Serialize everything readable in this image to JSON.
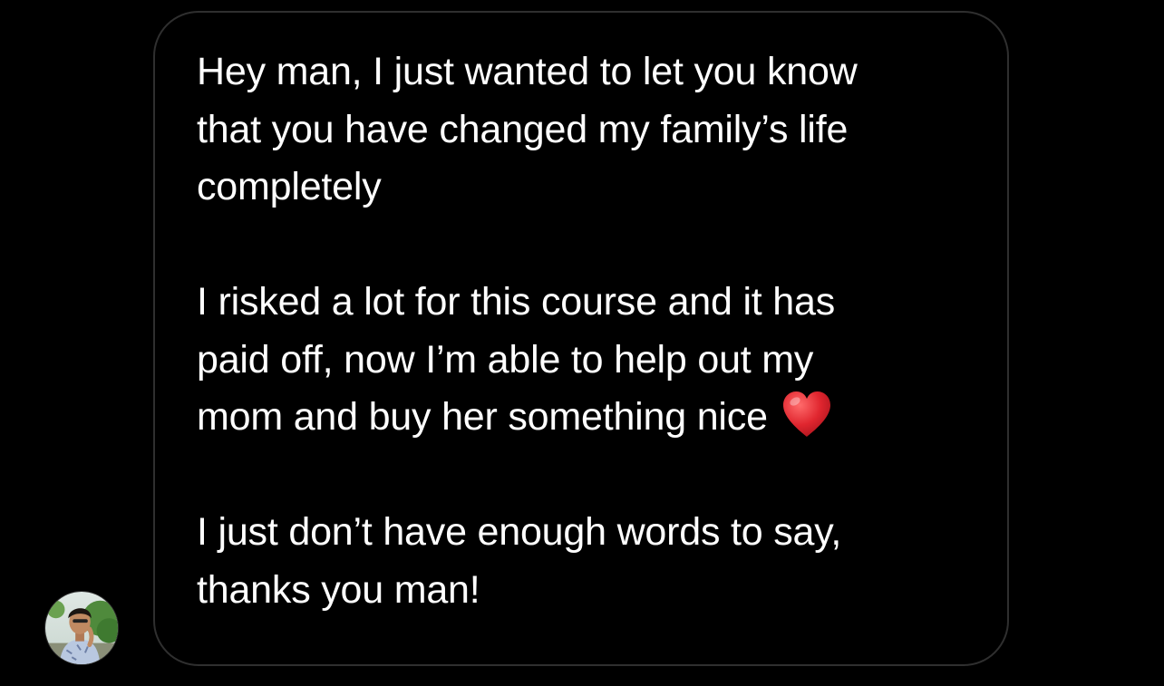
{
  "colors": {
    "background": "#000000",
    "bubble_border": "#2f2f2f",
    "text": "#ffffff",
    "heart": "#e0262f"
  },
  "sender": {
    "avatar_icon": "profile-photo"
  },
  "message": {
    "paragraphs": [
      {
        "lines": [
          "Hey man, I just wanted to let you know",
          "that you have changed my family’s life",
          "completely"
        ]
      },
      {
        "lines": [
          "I risked a lot for this course and it has",
          "paid off, now I’m able to help out my",
          "mom and buy her something nice"
        ],
        "trailing_emoji": "red-heart-emoji"
      },
      {
        "lines": [
          "I just don’t have enough words to say,",
          "thanks you man!"
        ]
      }
    ]
  }
}
